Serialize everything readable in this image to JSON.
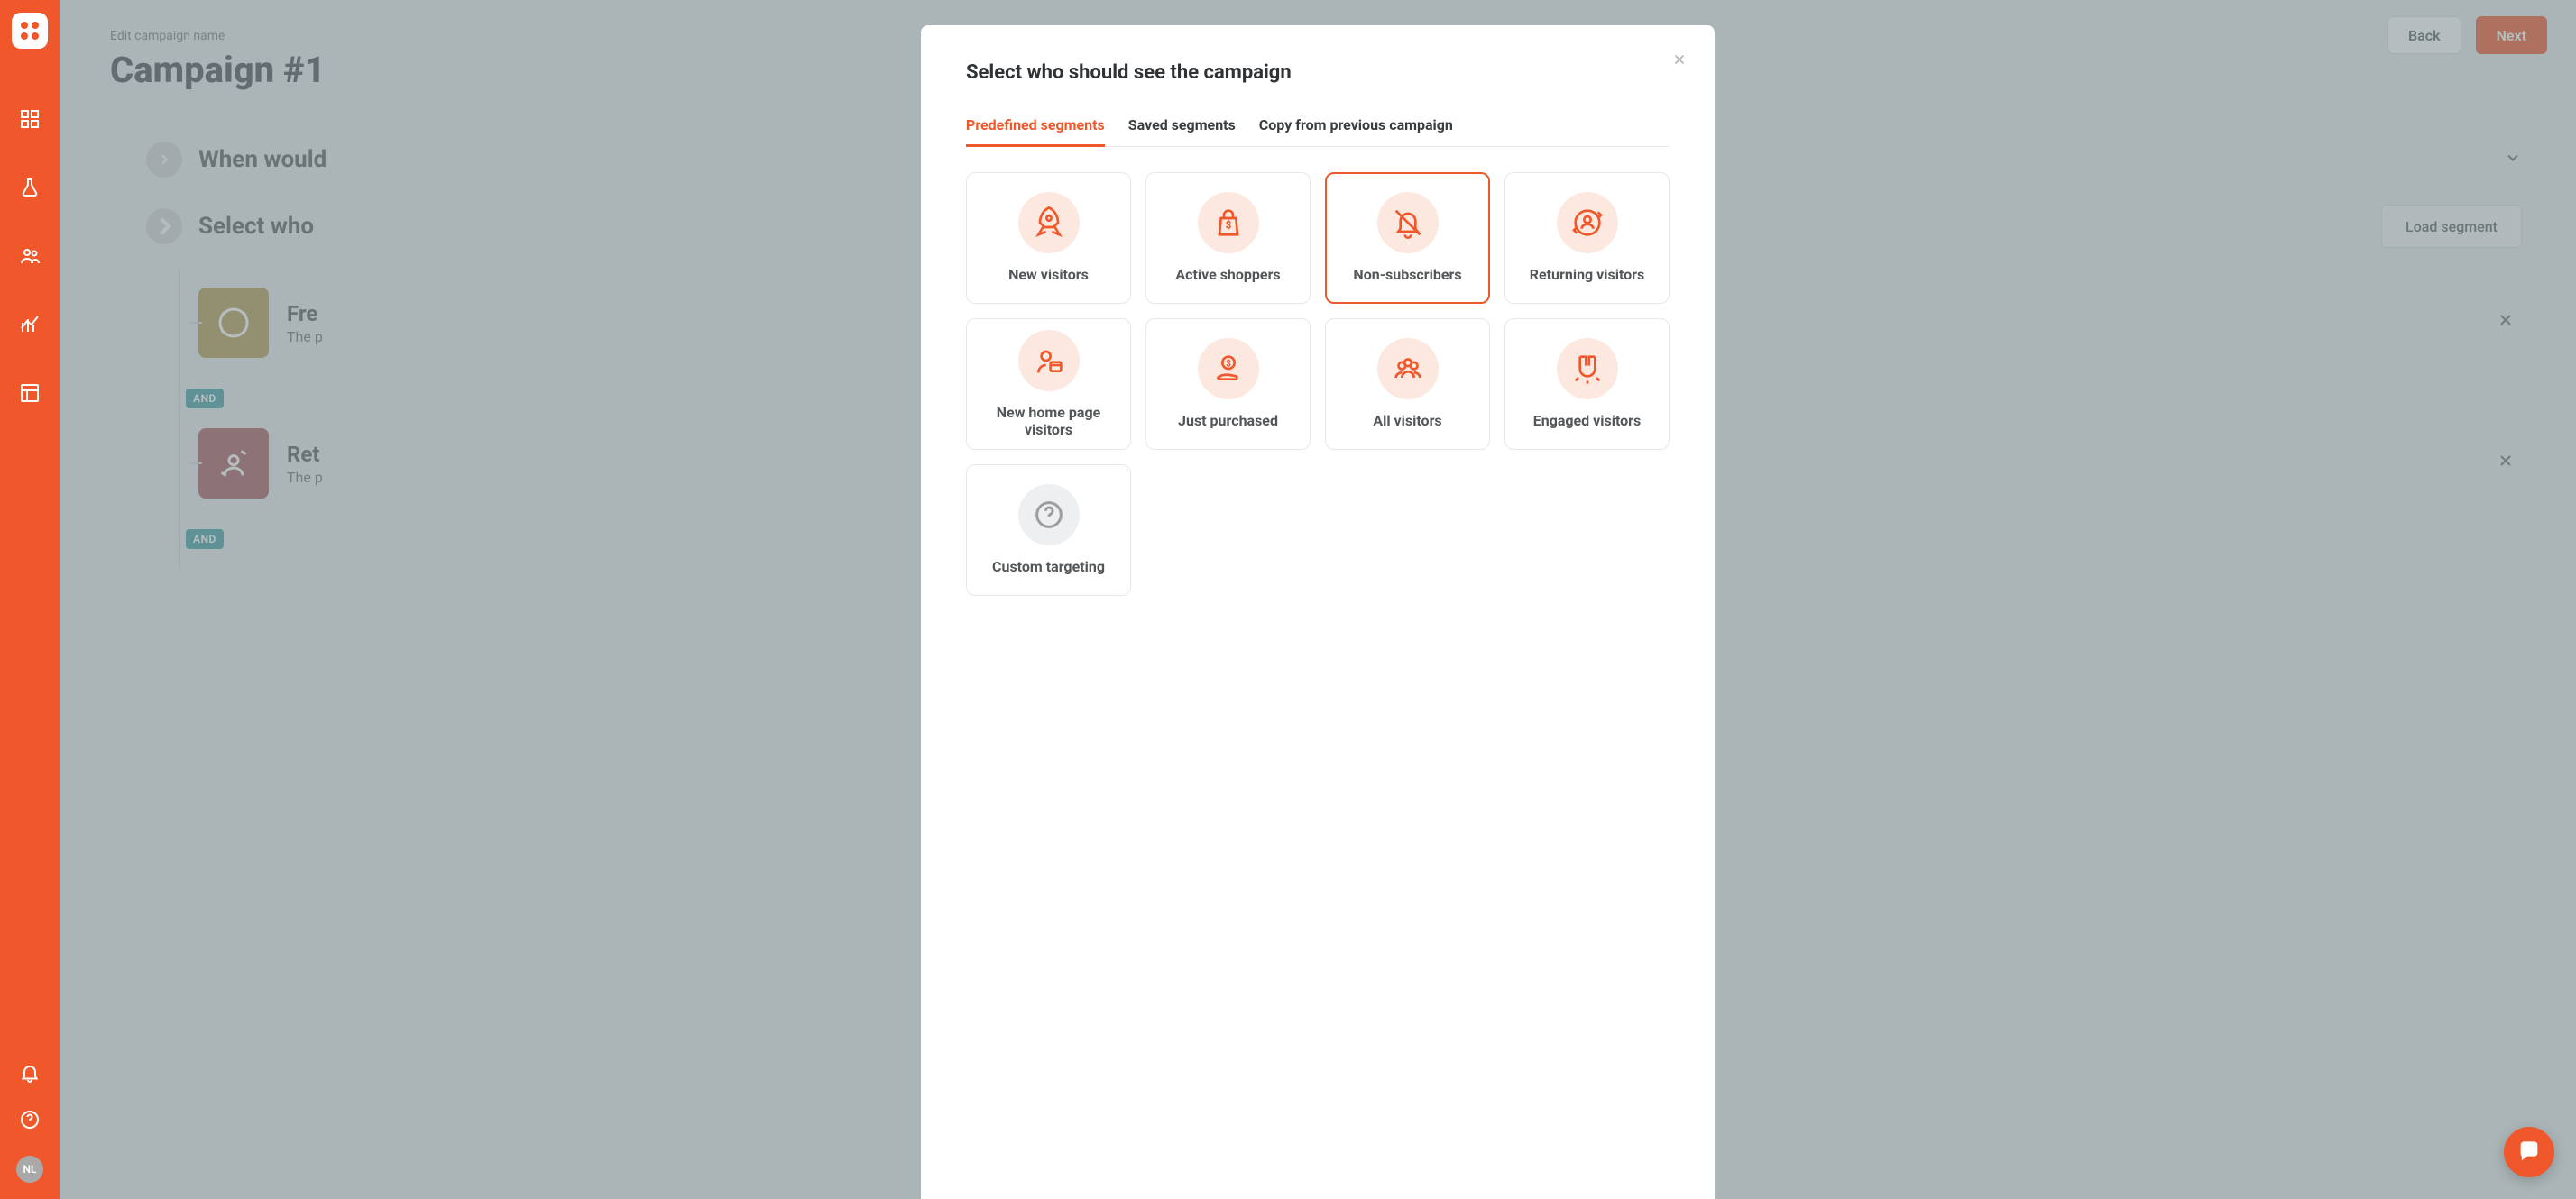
{
  "colors": {
    "accent": "#f0572b",
    "teal": "#3ea0a6"
  },
  "sidebar": {
    "avatar_initials": "NL",
    "items": [
      {
        "name": "dashboard"
      },
      {
        "name": "experiments"
      },
      {
        "name": "audiences"
      },
      {
        "name": "analytics"
      },
      {
        "name": "layouts"
      }
    ],
    "bottom": [
      {
        "name": "notifications"
      },
      {
        "name": "help"
      }
    ]
  },
  "topbar": {
    "back": "Back",
    "next": "Next"
  },
  "page": {
    "edit_label": "Edit campaign name",
    "title": "Campaign #1",
    "section_when": "When would",
    "section_who": "Select who",
    "load_segment": "Load segment",
    "and_label": "AND",
    "rules": [
      {
        "title": "Fre",
        "subtitle": "The p",
        "variant": "gold"
      },
      {
        "title": "Ret",
        "subtitle": "The p",
        "variant": "rose"
      }
    ]
  },
  "modal": {
    "title": "Select who should see the campaign",
    "tabs": [
      {
        "label": "Predefined segments",
        "active": true
      },
      {
        "label": "Saved segments",
        "active": false
      },
      {
        "label": "Copy from previous campaign",
        "active": false
      }
    ],
    "segments": [
      {
        "id": "new-visitors",
        "label": "New visitors",
        "icon": "rocket",
        "selected": false
      },
      {
        "id": "active-shoppers",
        "label": "Active shoppers",
        "icon": "bag",
        "selected": false
      },
      {
        "id": "non-subscribers",
        "label": "Non-subscribers",
        "icon": "bell-off",
        "selected": true
      },
      {
        "id": "returning-visitors",
        "label": "Returning visitors",
        "icon": "refresh-user",
        "selected": false
      },
      {
        "id": "new-home-page-visitors",
        "label": "New home page visitors",
        "icon": "user-home",
        "selected": false
      },
      {
        "id": "just-purchased",
        "label": "Just purchased",
        "icon": "coin-hand",
        "selected": false
      },
      {
        "id": "all-visitors",
        "label": "All visitors",
        "icon": "crowd",
        "selected": false
      },
      {
        "id": "engaged-visitors",
        "label": "Engaged visitors",
        "icon": "magnet",
        "selected": false
      },
      {
        "id": "custom-targeting",
        "label": "Custom targeting",
        "icon": "question",
        "selected": false,
        "muted": true
      }
    ]
  }
}
